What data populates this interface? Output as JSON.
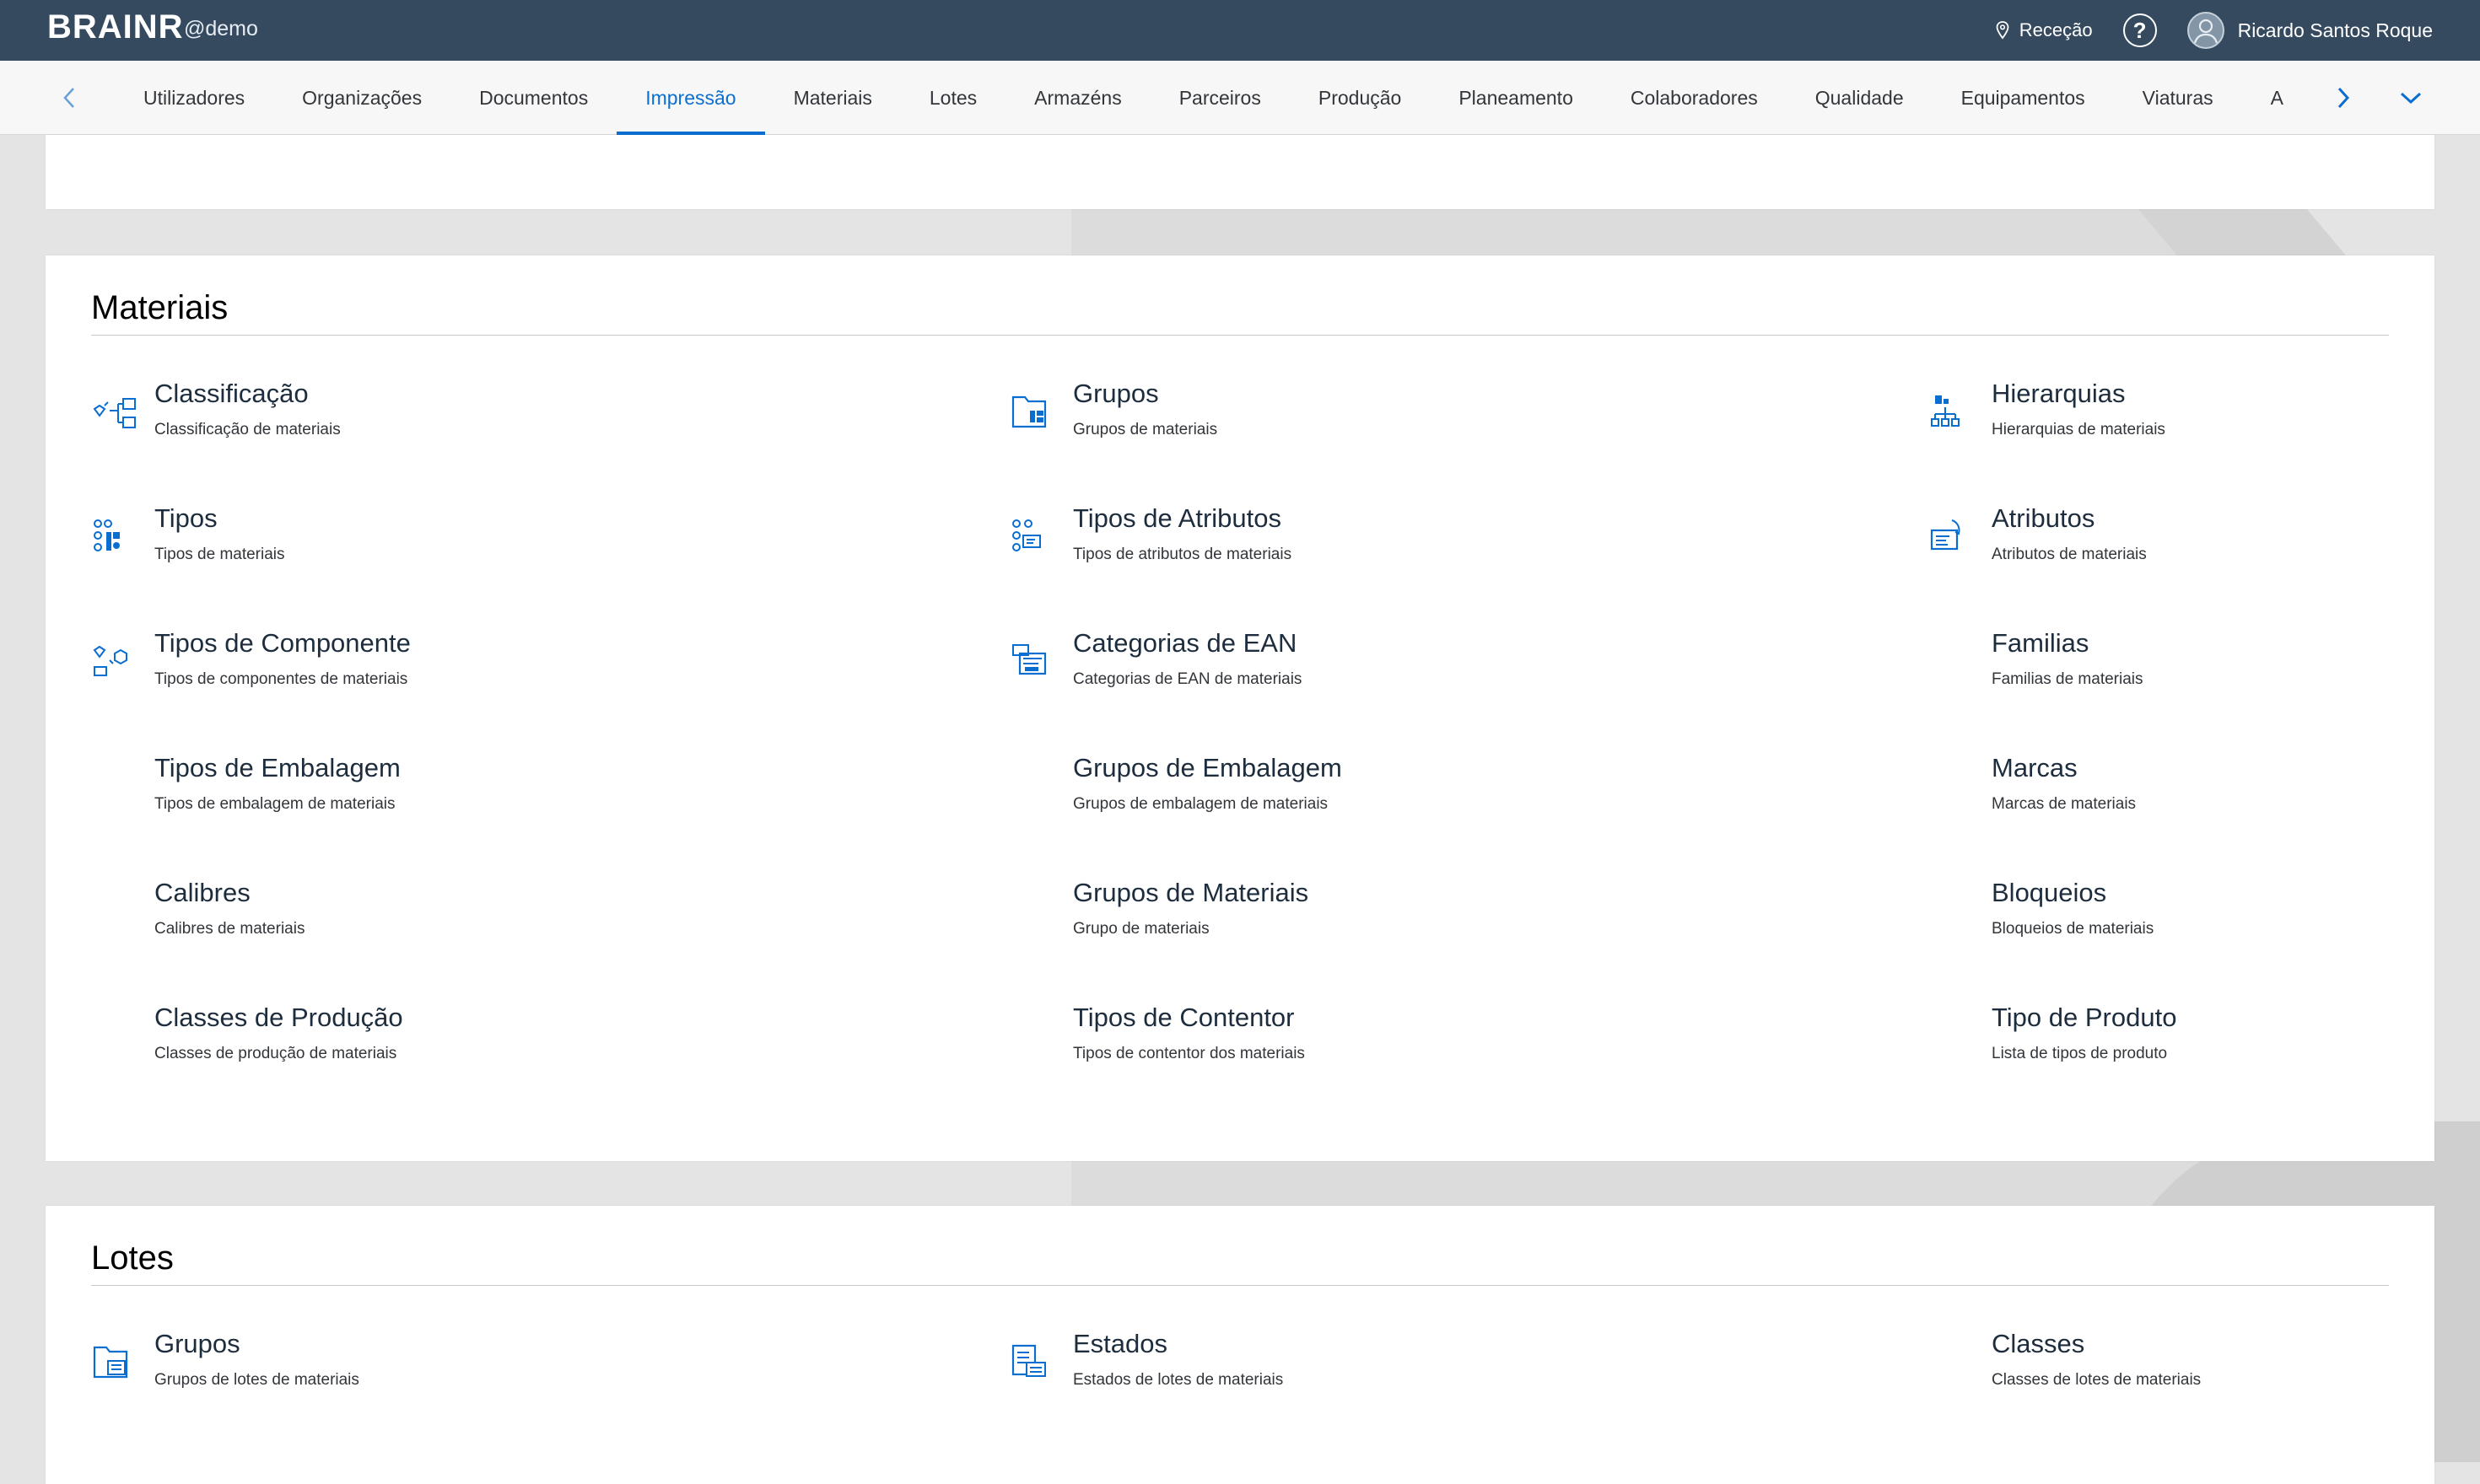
{
  "shell": {
    "logo": "BRAINR",
    "tenant": "@demo",
    "location": "Receção",
    "user_name": "Ricardo Santos Roque"
  },
  "tabs": [
    {
      "label": "Utilizadores"
    },
    {
      "label": "Organizações"
    },
    {
      "label": "Documentos"
    },
    {
      "label": "Impressão",
      "active": true
    },
    {
      "label": "Materiais"
    },
    {
      "label": "Lotes"
    },
    {
      "label": "Armazéns"
    },
    {
      "label": "Parceiros"
    },
    {
      "label": "Produção"
    },
    {
      "label": "Planeamento"
    },
    {
      "label": "Colaboradores"
    },
    {
      "label": "Qualidade"
    },
    {
      "label": "Equipamentos"
    },
    {
      "label": "Viaturas"
    },
    {
      "label": "A"
    }
  ],
  "materiais": {
    "title": "Materiais",
    "items": [
      {
        "title": "Classificação",
        "subtitle": "Classificação de materiais",
        "icon": "classification-icon"
      },
      {
        "title": "Grupos",
        "subtitle": "Grupos de materiais",
        "icon": "group-folder-icon"
      },
      {
        "title": "Hierarquias",
        "subtitle": "Hierarquias de materiais",
        "icon": "hierarchy-icon"
      },
      {
        "title": "Tipos",
        "subtitle": "Tipos de materiais",
        "icon": "types-icon"
      },
      {
        "title": "Tipos de Atributos",
        "subtitle": "Tipos de atributos de materiais",
        "icon": "attribute-types-icon"
      },
      {
        "title": "Atributos",
        "subtitle": "Atributos de materiais",
        "icon": "attributes-icon"
      },
      {
        "title": "Tipos de Componente",
        "subtitle": "Tipos de componentes de materiais",
        "icon": "component-types-icon"
      },
      {
        "title": "Categorias de EAN",
        "subtitle": "Categorias de EAN de materiais",
        "icon": "ean-categories-icon"
      },
      {
        "title": "Familias",
        "subtitle": "Familias de materiais",
        "icon": ""
      },
      {
        "title": "Tipos de Embalagem",
        "subtitle": "Tipos de embalagem de materiais",
        "icon": ""
      },
      {
        "title": "Grupos de Embalagem",
        "subtitle": "Grupos de embalagem de materiais",
        "icon": ""
      },
      {
        "title": "Marcas",
        "subtitle": "Marcas de materiais",
        "icon": ""
      },
      {
        "title": "Calibres",
        "subtitle": "Calibres de materiais",
        "icon": ""
      },
      {
        "title": "Grupos de Materiais",
        "subtitle": "Grupo de materiais",
        "icon": ""
      },
      {
        "title": "Bloqueios",
        "subtitle": "Bloqueios de materiais",
        "icon": ""
      },
      {
        "title": "Classes de Produção",
        "subtitle": "Classes de produção de materiais",
        "icon": ""
      },
      {
        "title": "Tipos de Contentor",
        "subtitle": "Tipos de contentor dos materiais",
        "icon": ""
      },
      {
        "title": "Tipo de Produto",
        "subtitle": "Lista de tipos de produto",
        "icon": ""
      }
    ]
  },
  "lotes": {
    "title": "Lotes",
    "items": [
      {
        "title": "Grupos",
        "subtitle": "Grupos de lotes de materiais",
        "icon": "lot-groups-icon"
      },
      {
        "title": "Estados",
        "subtitle": "Estados de lotes de materiais",
        "icon": "lot-states-icon"
      },
      {
        "title": "Classes",
        "subtitle": "Classes de lotes de materiais",
        "icon": ""
      }
    ]
  },
  "colors": {
    "shell": "#354a5f",
    "accent": "#0a6ed1",
    "icon": "#0a6ed1"
  }
}
